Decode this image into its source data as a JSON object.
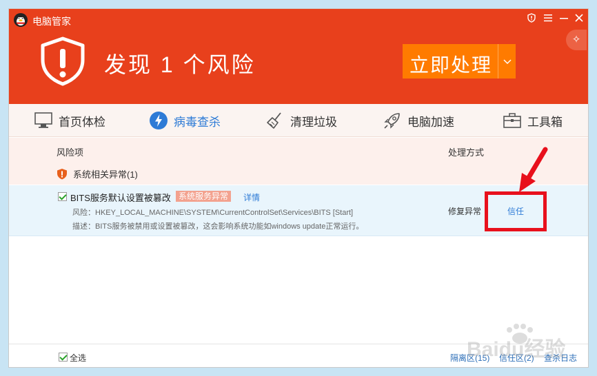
{
  "app": {
    "title": "电脑管家"
  },
  "header": {
    "headline": "发现 1 个风险",
    "fix_button": "立即处理",
    "bg_color": "#e8401c",
    "button_color": "#ff7b00"
  },
  "nav": {
    "tabs": [
      {
        "label": "首页体检",
        "icon": "monitor-icon"
      },
      {
        "label": "病毒查杀",
        "icon": "lightning-icon",
        "active": true
      },
      {
        "label": "清理垃圾",
        "icon": "broom-icon"
      },
      {
        "label": "电脑加速",
        "icon": "rocket-icon"
      },
      {
        "label": "工具箱",
        "icon": "toolbox-icon"
      }
    ]
  },
  "table": {
    "col_risk": "风险项",
    "col_action": "处理方式",
    "group_label": "系统相关异常(1)",
    "item": {
      "title": "BITS服务默认设置被篡改",
      "tag": "系统服务异常",
      "detail_link": "详情",
      "risk_line": "风险：HKEY_LOCAL_MACHINE\\SYSTEM\\CurrentControlSet\\Services\\BITS [Start]",
      "desc_line": "描述：BITS服务被禁用或设置被篡改，这会影响系统功能如windows update正常运行。",
      "action": "修复异常",
      "trust": "信任"
    }
  },
  "footer": {
    "select_all": "全选",
    "quarantine": "隔离区(15)",
    "trust_zone": "信任区(2)",
    "log": "查杀日志"
  },
  "watermark": {
    "text": "Baidu经验"
  }
}
